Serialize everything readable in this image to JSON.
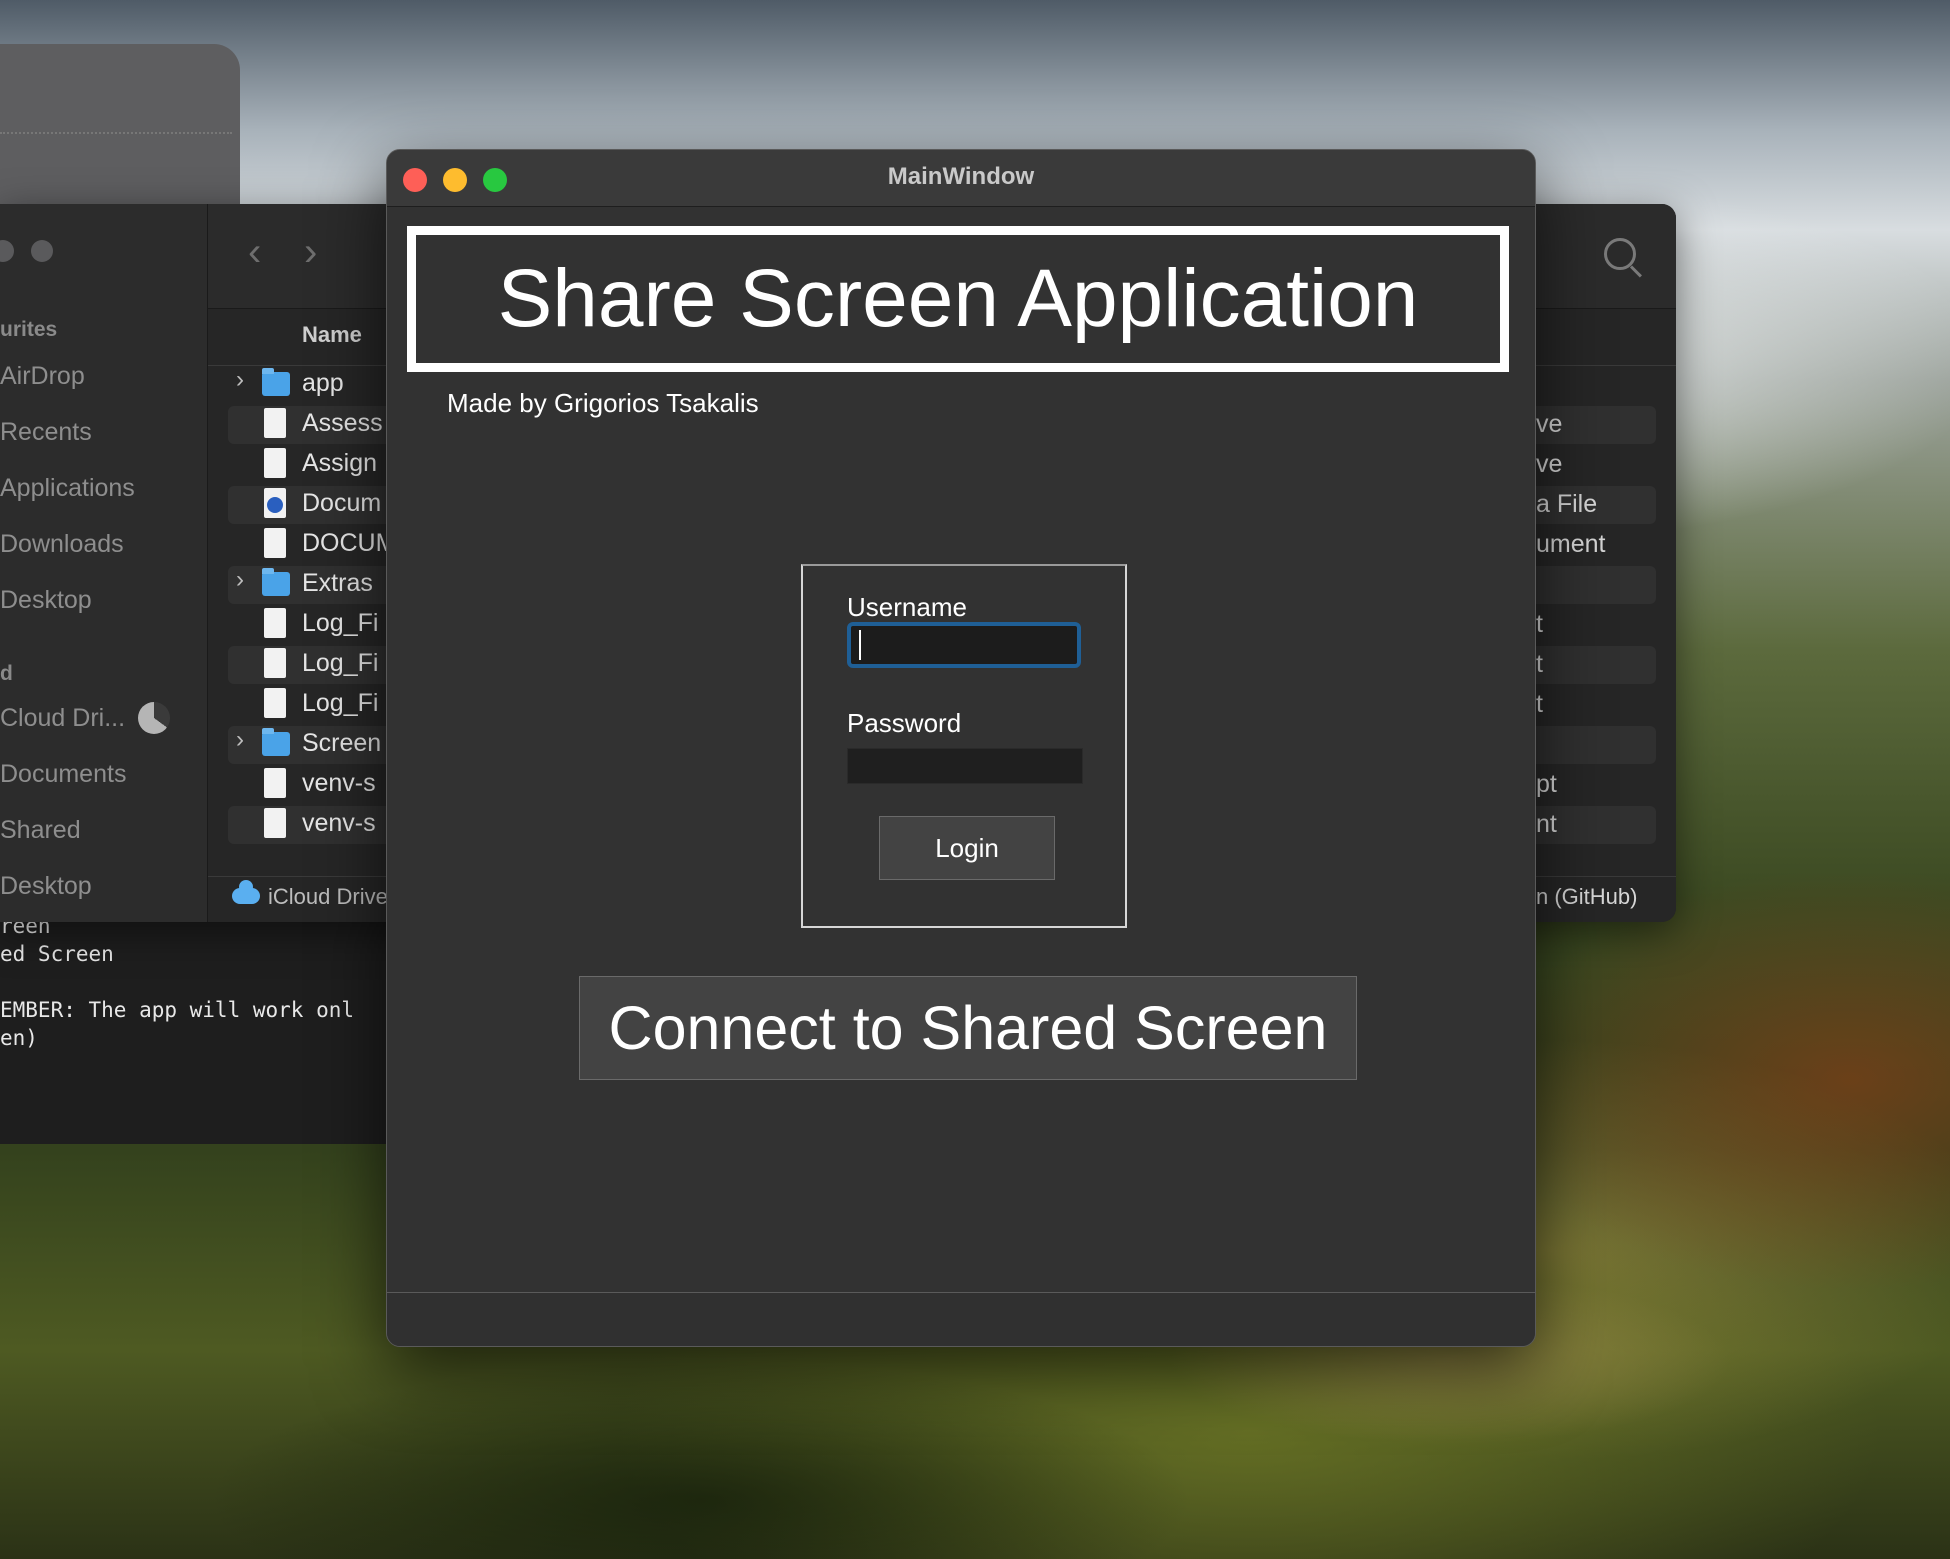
{
  "main_window": {
    "title": "MainWindow",
    "header_title": "Share Screen Application",
    "credit": "Made by Grigorios Tsakalis",
    "login": {
      "username_label": "Username",
      "username_value": "",
      "password_label": "Password",
      "password_value": "",
      "login_button": "Login"
    },
    "connect_button": "Connect to Shared Screen"
  },
  "finder": {
    "sidebar_sections": [
      "urites",
      "d"
    ],
    "sidebar_items": [
      "AirDrop",
      "Recents",
      "Applications",
      "Downloads",
      "Desktop",
      "Cloud Dri...",
      "Documents",
      "Shared",
      "Desktop"
    ],
    "column_name": "Name",
    "files": [
      "app",
      "Assess",
      "Assign",
      "Docum",
      "DOCUM",
      "Extras",
      "Log_Fi",
      "Log_Fi",
      "Log_Fi",
      "Screen",
      "venv-s",
      "venv-s"
    ],
    "right_labels": [
      "ve",
      "ve",
      "a File",
      "ument",
      "t",
      "t",
      "t",
      "pt",
      "nt"
    ],
    "status_left": "iCloud Drive",
    "status_right": "n (GitHub)"
  },
  "terminal": {
    "lines": [
      "reen",
      "ed Screen",
      "",
      "EMBER: The app will work onl",
      "en)"
    ]
  }
}
